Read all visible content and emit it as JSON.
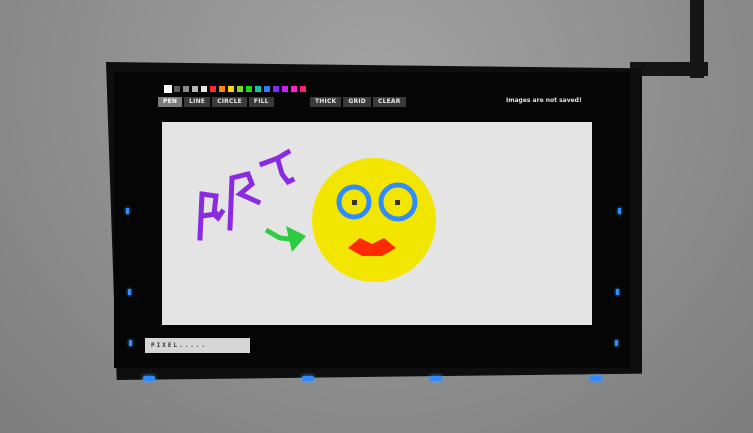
{
  "palette": {
    "colors": [
      "#ffffff",
      "#5c5c5c",
      "#8a8a8a",
      "#b8b8b8",
      "#e6e6e6",
      "#ff2a2a",
      "#ff8a00",
      "#ffd800",
      "#7ddc1f",
      "#14d914",
      "#10c8a8",
      "#2f7dff",
      "#7a2fff",
      "#c81fff",
      "#ff22c8",
      "#ff1f6e"
    ],
    "selected_index": 0
  },
  "toolbar": {
    "pen": "PEN",
    "line": "LINE",
    "circle": "CIRCLE",
    "fill": "FILL",
    "thick": "THICK",
    "grid": "GRID",
    "clear": "CLEAR",
    "active_tool": "pen"
  },
  "notice": "Images are not saved!",
  "status_text": "PIXEL.....",
  "drawing": {
    "text_color": "#8a2be2",
    "arrow_color": "#2ecc40",
    "face_color": "#f2e600",
    "eye_ring_color": "#2f8cff",
    "pupil_color": "#333333",
    "lips_color": "#ff2a00"
  }
}
